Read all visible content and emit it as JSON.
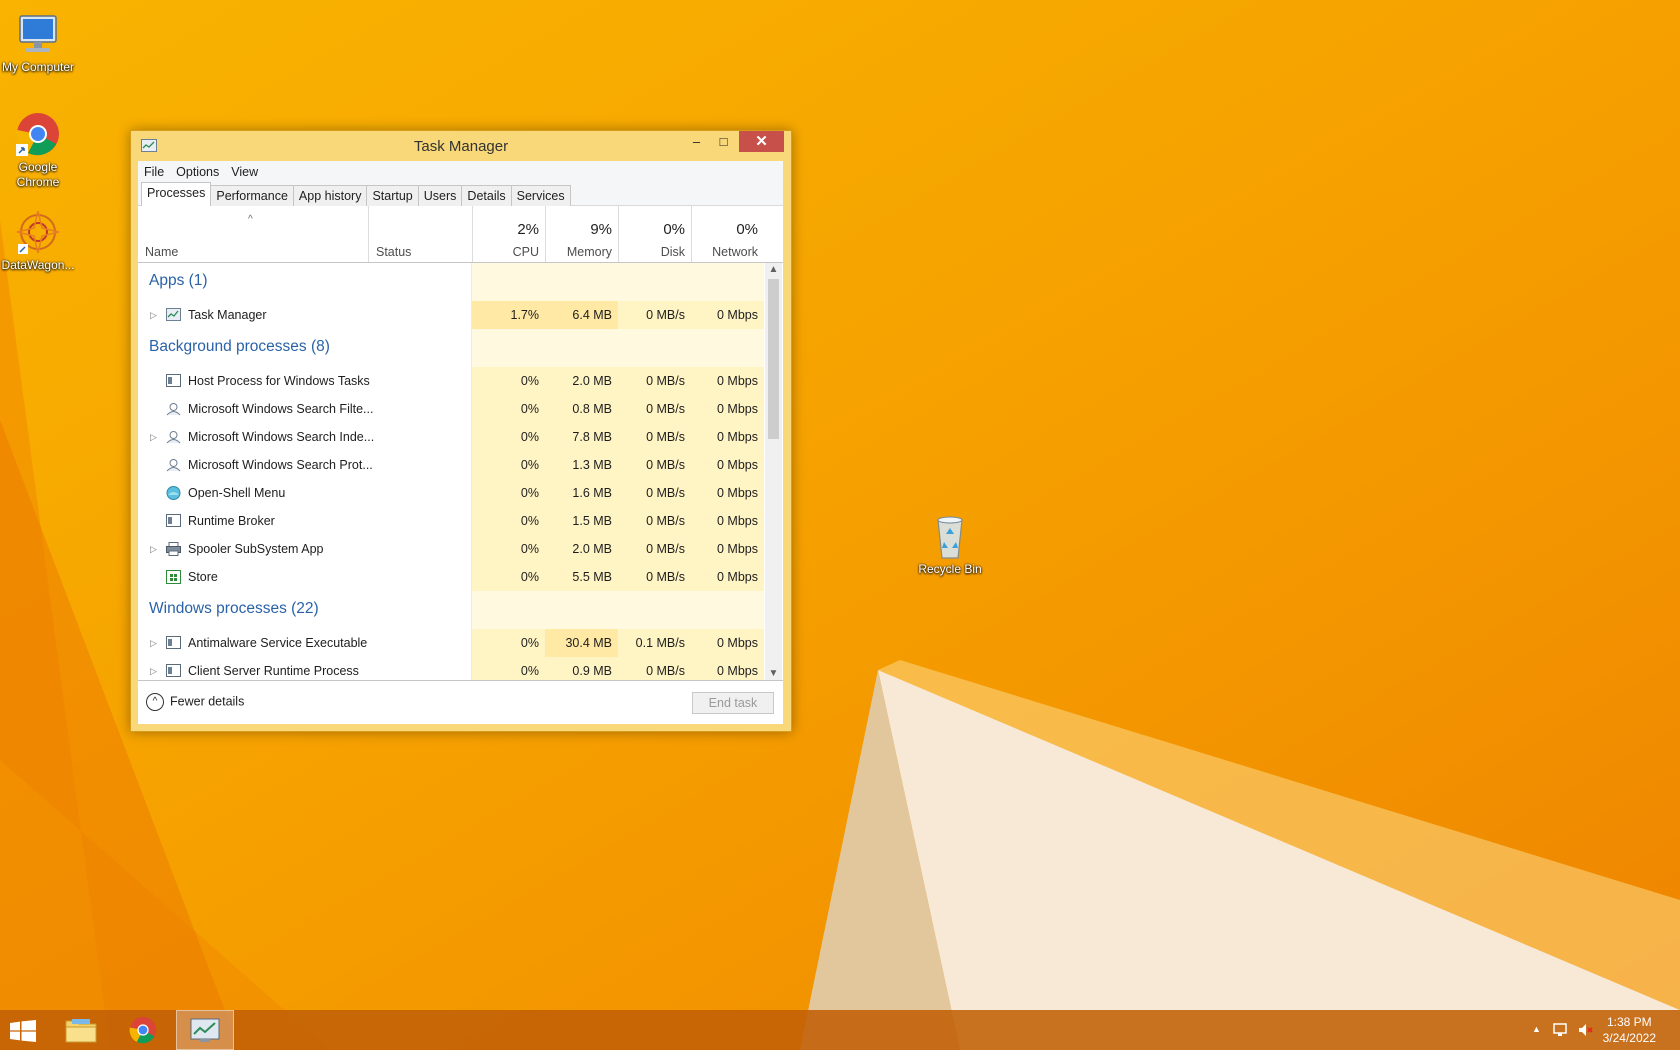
{
  "desktop": {
    "icons": [
      {
        "label": "My Computer",
        "icon": "computer-icon"
      },
      {
        "label": "Google Chrome",
        "icon": "chrome-icon"
      },
      {
        "label": "DataWagon...",
        "icon": "datawagon-icon"
      },
      {
        "label": "Recycle Bin",
        "icon": "recycle-bin-icon"
      }
    ]
  },
  "window": {
    "title": "Task Manager",
    "minimize": "–",
    "maximize": "□",
    "close": "✕"
  },
  "menu": [
    "File",
    "Options",
    "View"
  ],
  "tabs": [
    "Processes",
    "Performance",
    "App history",
    "Startup",
    "Users",
    "Details",
    "Services"
  ],
  "active_tab": "Processes",
  "columns": {
    "name": "Name",
    "status": "Status",
    "cpu": {
      "label": "CPU",
      "pct": "2%"
    },
    "memory": {
      "label": "Memory",
      "pct": "9%"
    },
    "disk": {
      "label": "Disk",
      "pct": "0%"
    },
    "network": {
      "label": "Network",
      "pct": "0%"
    }
  },
  "groups": [
    {
      "name": "Apps (1)",
      "rows": [
        {
          "name": "Task Manager",
          "expand": true,
          "icon": "task-manager-icon",
          "cpu": "1.7%",
          "mem": "6.4 MB",
          "disk": "0 MB/s",
          "net": "0 Mbps"
        }
      ]
    },
    {
      "name": "Background processes (8)",
      "rows": [
        {
          "name": "Host Process for Windows Tasks",
          "expand": false,
          "icon": "window-app-icon",
          "cpu": "0%",
          "mem": "2.0 MB",
          "disk": "0 MB/s",
          "net": "0 Mbps"
        },
        {
          "name": "Microsoft Windows Search Filte...",
          "expand": false,
          "icon": "search-user-icon",
          "cpu": "0%",
          "mem": "0.8 MB",
          "disk": "0 MB/s",
          "net": "0 Mbps"
        },
        {
          "name": "Microsoft Windows Search Inde...",
          "expand": true,
          "icon": "search-user-icon",
          "cpu": "0%",
          "mem": "7.8 MB",
          "disk": "0 MB/s",
          "net": "0 Mbps"
        },
        {
          "name": "Microsoft Windows Search Prot...",
          "expand": false,
          "icon": "search-user-icon",
          "cpu": "0%",
          "mem": "1.3 MB",
          "disk": "0 MB/s",
          "net": "0 Mbps"
        },
        {
          "name": "Open-Shell Menu",
          "expand": false,
          "icon": "shell-icon",
          "cpu": "0%",
          "mem": "1.6 MB",
          "disk": "0 MB/s",
          "net": "0 Mbps"
        },
        {
          "name": "Runtime Broker",
          "expand": false,
          "icon": "window-app-icon",
          "cpu": "0%",
          "mem": "1.5 MB",
          "disk": "0 MB/s",
          "net": "0 Mbps"
        },
        {
          "name": "Spooler SubSystem App",
          "expand": true,
          "icon": "printer-icon",
          "cpu": "0%",
          "mem": "2.0 MB",
          "disk": "0 MB/s",
          "net": "0 Mbps"
        },
        {
          "name": "Store",
          "expand": false,
          "icon": "store-icon",
          "cpu": "0%",
          "mem": "5.5 MB",
          "disk": "0 MB/s",
          "net": "0 Mbps"
        }
      ]
    },
    {
      "name": "Windows processes (22)",
      "rows": [
        {
          "name": "Antimalware Service Executable",
          "expand": true,
          "icon": "window-app-icon",
          "cpu": "0%",
          "mem": "30.4 MB",
          "disk": "0.1 MB/s",
          "net": "0 Mbps"
        },
        {
          "name": "Client Server Runtime Process",
          "expand": true,
          "icon": "window-app-icon",
          "cpu": "0%",
          "mem": "0.9 MB",
          "disk": "0 MB/s",
          "net": "0 Mbps"
        }
      ]
    }
  ],
  "footer": {
    "fewer_details": "Fewer details",
    "end_task": "End task"
  },
  "taskbar": {
    "items": [
      "start-icon",
      "file-explorer-icon",
      "chrome-icon",
      "task-manager-icon"
    ],
    "time": "1:38 PM",
    "date": "3/24/2022"
  }
}
